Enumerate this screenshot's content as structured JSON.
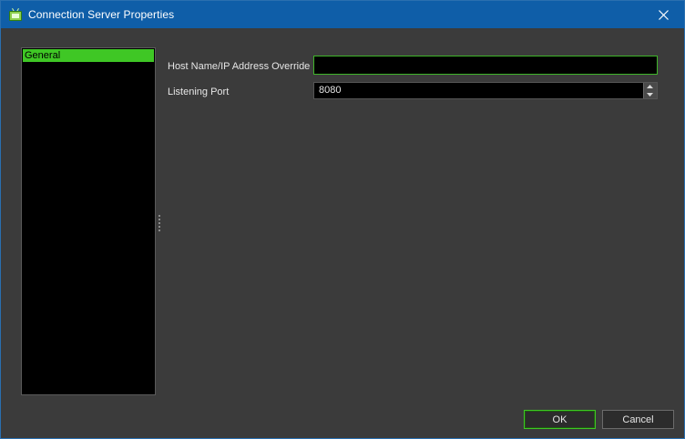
{
  "window": {
    "title": "Connection Server Properties",
    "accent_color": "#3fc725",
    "titlebar_color": "#0f5ea8"
  },
  "titlebar": {
    "app_icon": "tv-icon",
    "close_icon": "close-icon"
  },
  "nav": {
    "items": [
      {
        "label": "General",
        "selected": true
      }
    ]
  },
  "form": {
    "host_label": "Host Name/IP Address Override",
    "host_value": "",
    "port_label": "Listening Port",
    "port_value": "8080"
  },
  "buttons": {
    "ok_label": "OK",
    "cancel_label": "Cancel"
  }
}
